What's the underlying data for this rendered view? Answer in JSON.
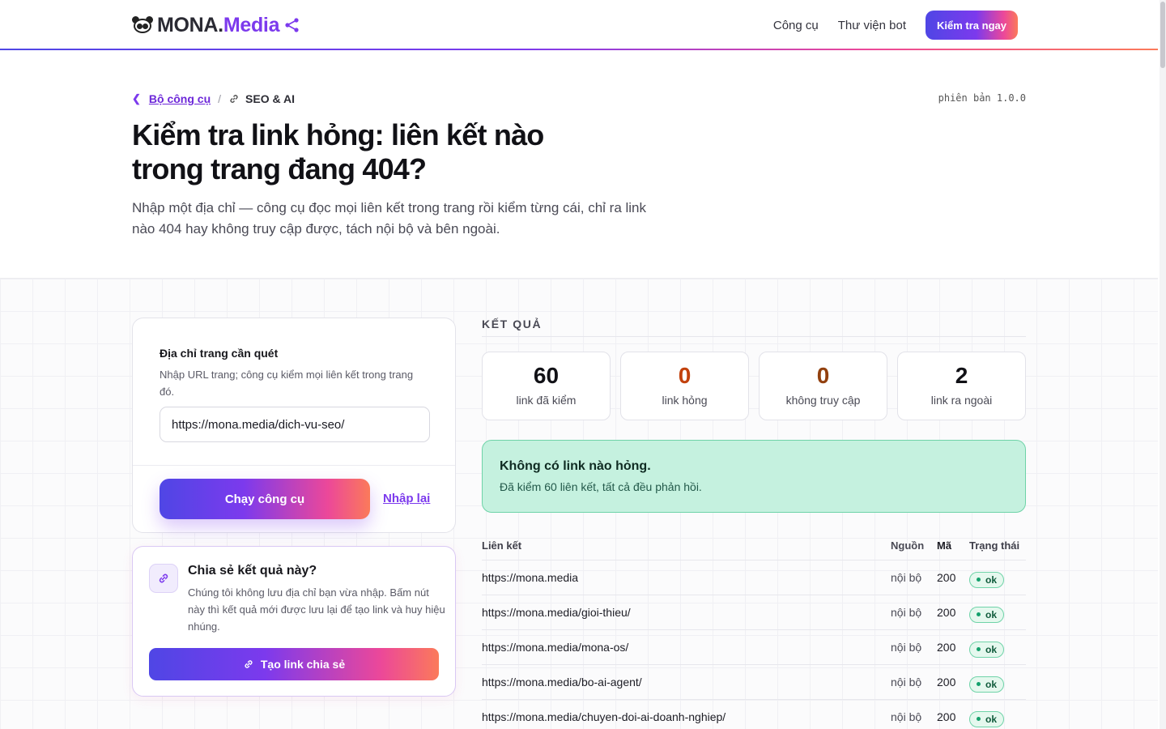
{
  "header": {
    "logo_text_main": "MONA.",
    "logo_text_accent": "Media",
    "nav": [
      "Công cụ",
      "Thư viện bot"
    ],
    "cta_label": "Kiểm tra ngay"
  },
  "breadcrumb": {
    "parent": "Bộ công cụ",
    "current": "SEO & AI"
  },
  "version": "phiên bản 1.0.0",
  "hero": {
    "title": "Kiểm tra link hỏng: liên kết nào trong trang đang 404?",
    "lead": "Nhập một địa chỉ — công cụ đọc mọi liên kết trong trang rồi kiểm từng cái, chỉ ra link nào 404 hay không truy cập được, tách nội bộ và bên ngoài."
  },
  "form": {
    "label": "Địa chỉ trang cần quét",
    "hint": "Nhập URL trang; công cụ kiểm mọi liên kết trong trang đó.",
    "url_value": "https://mona.media/dich-vu-seo/",
    "run_label": "Chạy công cụ",
    "reset_label": "Nhập lại"
  },
  "share": {
    "title": "Chia sẻ kết quả này?",
    "text": "Chúng tôi không lưu địa chỉ bạn vừa nhập. Bấm nút này thì kết quả mới được lưu lại để tạo link và huy hiệu nhúng.",
    "button_label": "Tạo link chia sẻ"
  },
  "results": {
    "label": "KẾT QUẢ",
    "stats": [
      {
        "value": "60",
        "caption": "link đã kiểm",
        "color": "#111116"
      },
      {
        "value": "0",
        "caption": "link hỏng",
        "color": "#c2410c"
      },
      {
        "value": "0",
        "caption": "không truy cập",
        "color": "#92400e"
      },
      {
        "value": "2",
        "caption": "link ra ngoài",
        "color": "#111116"
      }
    ],
    "alert_title": "Không có link nào hỏng.",
    "alert_text": "Đã kiểm 60 liên kết, tất cả đều phản hồi.",
    "columns": [
      "Liên kết",
      "Nguồn",
      "Mã",
      "Trạng thái"
    ],
    "rows": [
      {
        "url": "https://mona.media",
        "source": "nội bộ",
        "code": "200",
        "status": "ok"
      },
      {
        "url": "https://mona.media/gioi-thieu/",
        "source": "nội bộ",
        "code": "200",
        "status": "ok"
      },
      {
        "url": "https://mona.media/mona-os/",
        "source": "nội bộ",
        "code": "200",
        "status": "ok"
      },
      {
        "url": "https://mona.media/bo-ai-agent/",
        "source": "nội bộ",
        "code": "200",
        "status": "ok"
      },
      {
        "url": "https://mona.media/chuyen-doi-ai-doanh-nghiep/",
        "source": "nội bộ",
        "code": "200",
        "status": "ok"
      }
    ]
  },
  "colors": {
    "accent": "#7c3aed",
    "gradient_start": "#4f46e5",
    "gradient_end": "#fb7a5a",
    "success_bg": "#c5f1df"
  }
}
